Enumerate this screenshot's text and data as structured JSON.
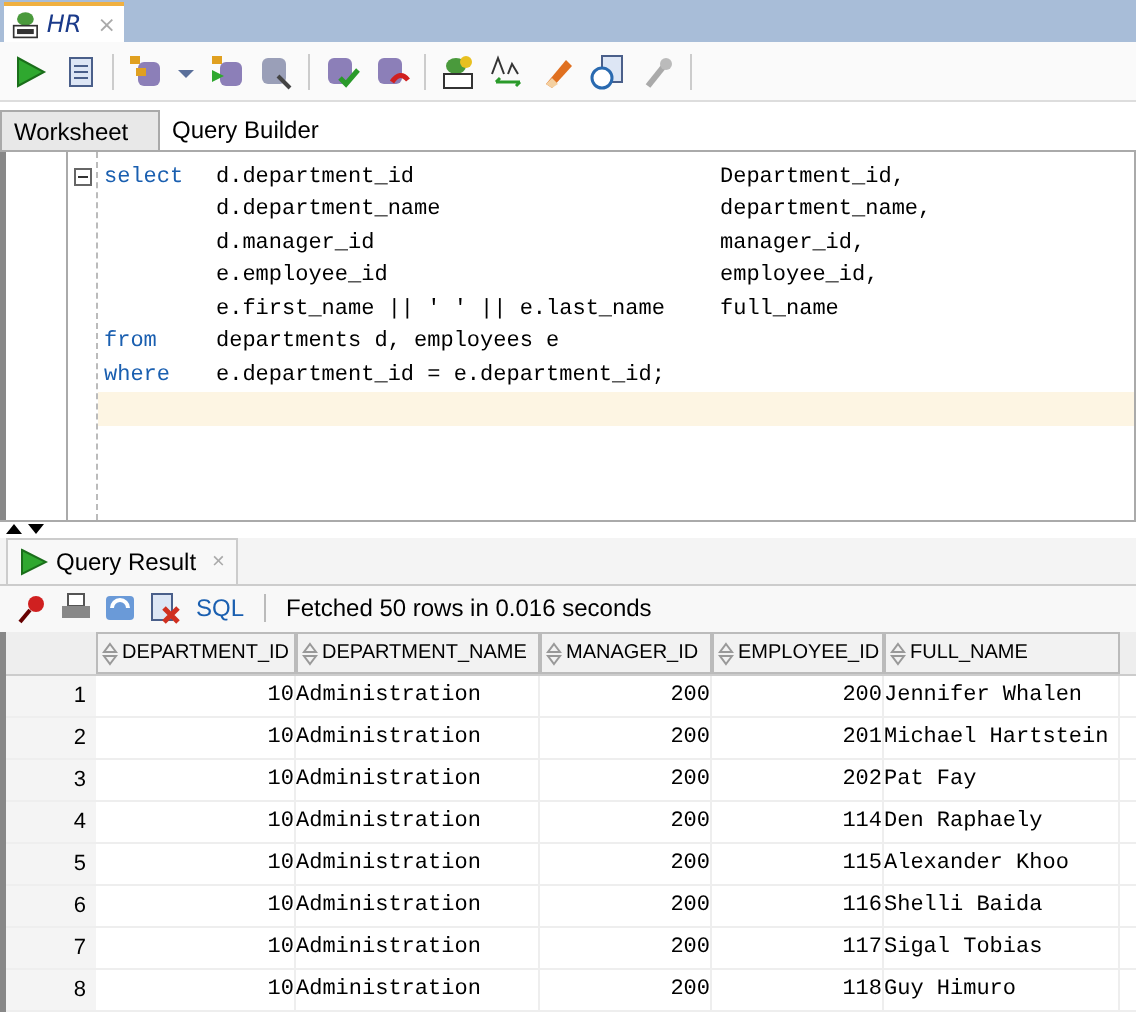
{
  "document_tab": {
    "title": "HR",
    "close": "×"
  },
  "editor_tabs": [
    {
      "label": "Worksheet",
      "selected": true
    },
    {
      "label": "Query Builder",
      "selected": false
    }
  ],
  "code_lines": [
    {
      "keyword": "select",
      "expr": "d.department_id",
      "alias": "Department_id,",
      "foldable": true,
      "current": false
    },
    {
      "expr": "d.department_name",
      "alias": "department_name,",
      "foldable": false,
      "current": false
    },
    {
      "expr": "d.manager_id",
      "alias": "manager_id,",
      "foldable": false,
      "current": false
    },
    {
      "expr": "e.employee_id",
      "alias": "employee_id,",
      "foldable": false,
      "current": false
    },
    {
      "expr": "e.first_name || ' ' || e.last_name",
      "alias": "full_name",
      "foldable": false,
      "current": false
    },
    {
      "keyword": "from",
      "expr": "departments d, employees e",
      "foldable": false,
      "current": false
    },
    {
      "keyword": "where",
      "expr": "e.department_id = e.department_id;",
      "foldable": false,
      "current": false
    },
    {
      "foldable": false,
      "current": true
    }
  ],
  "result_tab": {
    "title": "Query Result",
    "close": "×"
  },
  "result_toolbar": {
    "sql_link": "SQL",
    "status": "Fetched 50 rows in 0.016 seconds"
  },
  "table": {
    "columns": [
      {
        "label": "DEPARTMENT_ID"
      },
      {
        "label": "DEPARTMENT_NAME"
      },
      {
        "label": "MANAGER_ID"
      },
      {
        "label": "EMPLOYEE_ID"
      },
      {
        "label": "FULL_NAME"
      }
    ],
    "rows": [
      {
        "num": "1",
        "cells": [
          "10",
          "Administration",
          "200",
          "200",
          "Jennifer Whalen"
        ]
      },
      {
        "num": "2",
        "cells": [
          "10",
          "Administration",
          "200",
          "201",
          "Michael Hartstein"
        ]
      },
      {
        "num": "3",
        "cells": [
          "10",
          "Administration",
          "200",
          "202",
          "Pat Fay"
        ]
      },
      {
        "num": "4",
        "cells": [
          "10",
          "Administration",
          "200",
          "114",
          "Den Raphaely"
        ]
      },
      {
        "num": "5",
        "cells": [
          "10",
          "Administration",
          "200",
          "115",
          "Alexander Khoo"
        ]
      },
      {
        "num": "6",
        "cells": [
          "10",
          "Administration",
          "200",
          "116",
          "Shelli Baida"
        ]
      },
      {
        "num": "7",
        "cells": [
          "10",
          "Administration",
          "200",
          "117",
          "Sigal Tobias"
        ]
      },
      {
        "num": "8",
        "cells": [
          "10",
          "Administration",
          "200",
          "118",
          "Guy Himuro"
        ]
      }
    ]
  }
}
